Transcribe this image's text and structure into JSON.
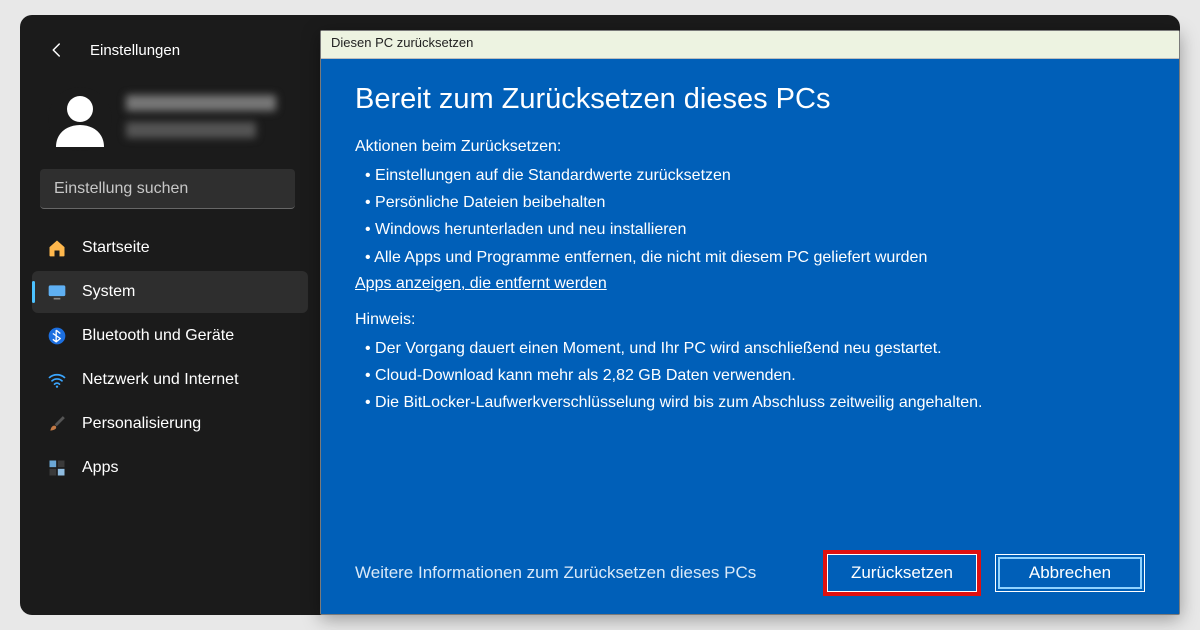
{
  "settings": {
    "title": "Einstellungen",
    "search_placeholder": "Einstellung suchen",
    "nav": [
      {
        "label": "Startseite"
      },
      {
        "label": "System"
      },
      {
        "label": "Bluetooth und Geräte"
      },
      {
        "label": "Netzwerk und Internet"
      },
      {
        "label": "Personalisierung"
      },
      {
        "label": "Apps"
      }
    ]
  },
  "dialog": {
    "title": "Diesen PC zurücksetzen",
    "heading": "Bereit zum Zurücksetzen dieses PCs",
    "actions_title": "Aktionen beim Zurücksetzen:",
    "actions": [
      "Einstellungen auf die Standardwerte zurücksetzen",
      "Persönliche Dateien beibehalten",
      "Windows herunterladen und neu installieren",
      "Alle Apps und Programme entfernen, die nicht mit diesem PC geliefert wurden"
    ],
    "apps_link": "Apps anzeigen, die entfernt werden",
    "notes_title": "Hinweis:",
    "notes": [
      "Der Vorgang dauert einen Moment, und Ihr PC wird anschließend neu gestartet.",
      "Cloud-Download kann mehr als 2,82 GB Daten verwenden.",
      "Die BitLocker-Laufwerkverschlüsselung wird bis zum Abschluss zeitweilig angehalten."
    ],
    "more_info": "Weitere Informationen zum Zurücksetzen dieses PCs",
    "reset_btn": "Zurücksetzen",
    "cancel_btn": "Abbrechen"
  }
}
